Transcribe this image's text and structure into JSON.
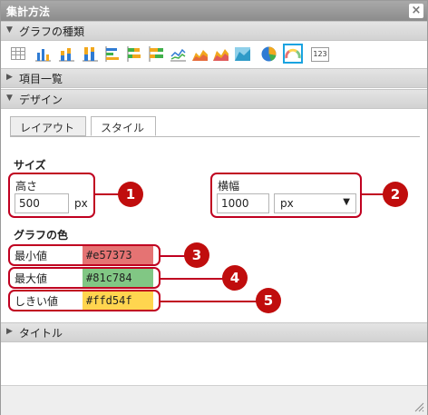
{
  "window": {
    "title": "集計方法",
    "close_glyph": "×"
  },
  "sections": {
    "graph_type": "グラフの種類",
    "items": "項目一覧",
    "design": "デザイン",
    "title": "タイトル"
  },
  "toolbar": {
    "icons": [
      "table-icon",
      "bar-chart-icon",
      "stacked-bar-icon",
      "percent-bar-icon",
      "horizontal-bar-icon",
      "stacked-horizontal-bar-icon",
      "percent-horizontal-bar-icon",
      "line-chart-icon",
      "area-chart-icon",
      "stacked-area-icon",
      "percent-area-icon",
      "pie-chart-icon",
      "gauge-chart-icon",
      "number-icon"
    ],
    "selected": "gauge-chart-icon",
    "number_text": "123"
  },
  "tabs": [
    "レイアウト",
    "スタイル"
  ],
  "active_tab": "スタイル",
  "size": {
    "heading": "サイズ",
    "height_label": "高さ",
    "height_value": "500",
    "height_unit": "px",
    "width_label": "横幅",
    "width_value": "1000",
    "width_unit": "px"
  },
  "colors": {
    "heading": "グラフの色",
    "min_label": "最小値",
    "min_value": "#e57373",
    "max_label": "最大値",
    "max_value": "#81c784",
    "threshold_label": "しきい値",
    "threshold_value": "#ffd54f"
  },
  "callouts": [
    "1",
    "2",
    "3",
    "4",
    "5"
  ],
  "accent": "#c00d0d",
  "selection": "#1aa3e0"
}
